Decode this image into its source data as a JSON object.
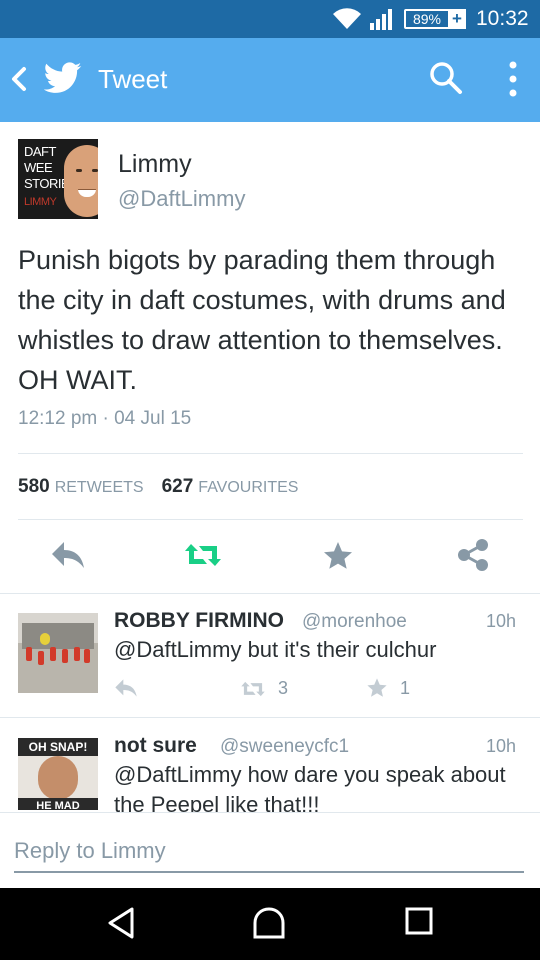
{
  "status_bar": {
    "battery": "89%",
    "time": "10:32"
  },
  "app_bar": {
    "title": "Tweet"
  },
  "tweet": {
    "avatar_lines": [
      "DAFT",
      "WEE",
      "STORIES",
      "LIMMY"
    ],
    "author_name": "Limmy",
    "author_handle": "@DaftLimmy",
    "text": "Punish bigots by parading them through the city in daft costumes, with drums and whistles to draw attention to themselves. OH WAIT.",
    "timestamp": "12:12 pm · 04 Jul 15",
    "retweets_count": "580",
    "retweets_label": "RETWEETS",
    "favourites_count": "627",
    "favourites_label": "FAVOURITES"
  },
  "replies": [
    {
      "name": "ROBBY FIRMINO",
      "handle": "@morenhoe",
      "time": "10h",
      "text": "@DaftLimmy but it's their culchur",
      "retweets": "3",
      "favourites": "1"
    },
    {
      "name": "not sure",
      "handle": "@sweeneycfc1",
      "time": "10h",
      "text": "@DaftLimmy how dare you speak about the Peepel like that!!!",
      "avatar_top": "OH SNAP!",
      "avatar_bottom": "HE MAD"
    }
  ],
  "composer": {
    "placeholder": "Reply to Limmy"
  },
  "colors": {
    "status_bar": "#1e6aa5",
    "app_bar": "#55acee",
    "retweet_green": "#19cf86",
    "icon_gray": "#8899a6"
  },
  "icons": {
    "back": "chevron-left-icon",
    "logo": "twitter-bird-icon",
    "search": "search-icon",
    "overflow": "more-vertical-icon",
    "reply": "reply-icon",
    "retweet": "retweet-icon",
    "favourite": "star-icon",
    "share": "share-icon",
    "nav_back": "triangle-back-icon",
    "nav_home": "home-icon",
    "nav_recents": "recents-icon"
  }
}
